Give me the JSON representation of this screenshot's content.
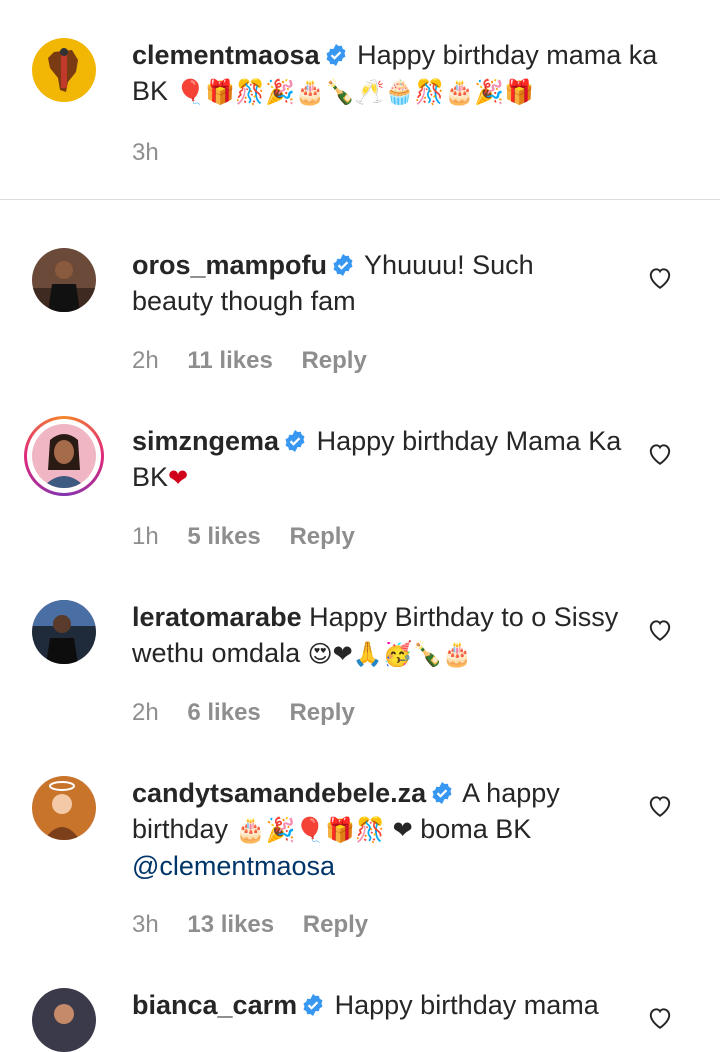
{
  "caption": {
    "username": "clementmaosa",
    "body": "Happy birthday mama ka BK",
    "emojis": "🎈🎁🎊🎉🎂🍾🥂🧁🎊🎂🎉🎁",
    "time": "3h"
  },
  "comments": [
    {
      "username": "oros_mampofu",
      "body": "Yhuuuu! Such beauty though fam",
      "time": "2h",
      "likes": "11 likes",
      "reply": "Reply"
    },
    {
      "username": "simzngema",
      "body": "Happy birthday Mama Ka BK",
      "emojis": "❤",
      "time": "1h",
      "likes": "5 likes",
      "reply": "Reply"
    },
    {
      "username": "leratomarabe",
      "body": "Happy Birthday to o Sissy wethu omdala",
      "emojis": "😍❤🙏🥳🍾🎂",
      "time": "2h",
      "likes": "6 likes",
      "reply": "Reply"
    },
    {
      "username": "candytsamandebele.za",
      "body": "A happy birthday",
      "emojis": "🎂🎉🎈🎁🎊 ❤",
      "body2": "boma BK",
      "mention": "@clementmaosa",
      "time": "3h",
      "likes": "13 likes",
      "reply": "Reply"
    },
    {
      "username": "bianca_carm",
      "body": "Happy birthday mama"
    }
  ],
  "colors": {
    "verified": "#3897f0",
    "meta": "#8e8e8e",
    "mention": "#003569"
  }
}
